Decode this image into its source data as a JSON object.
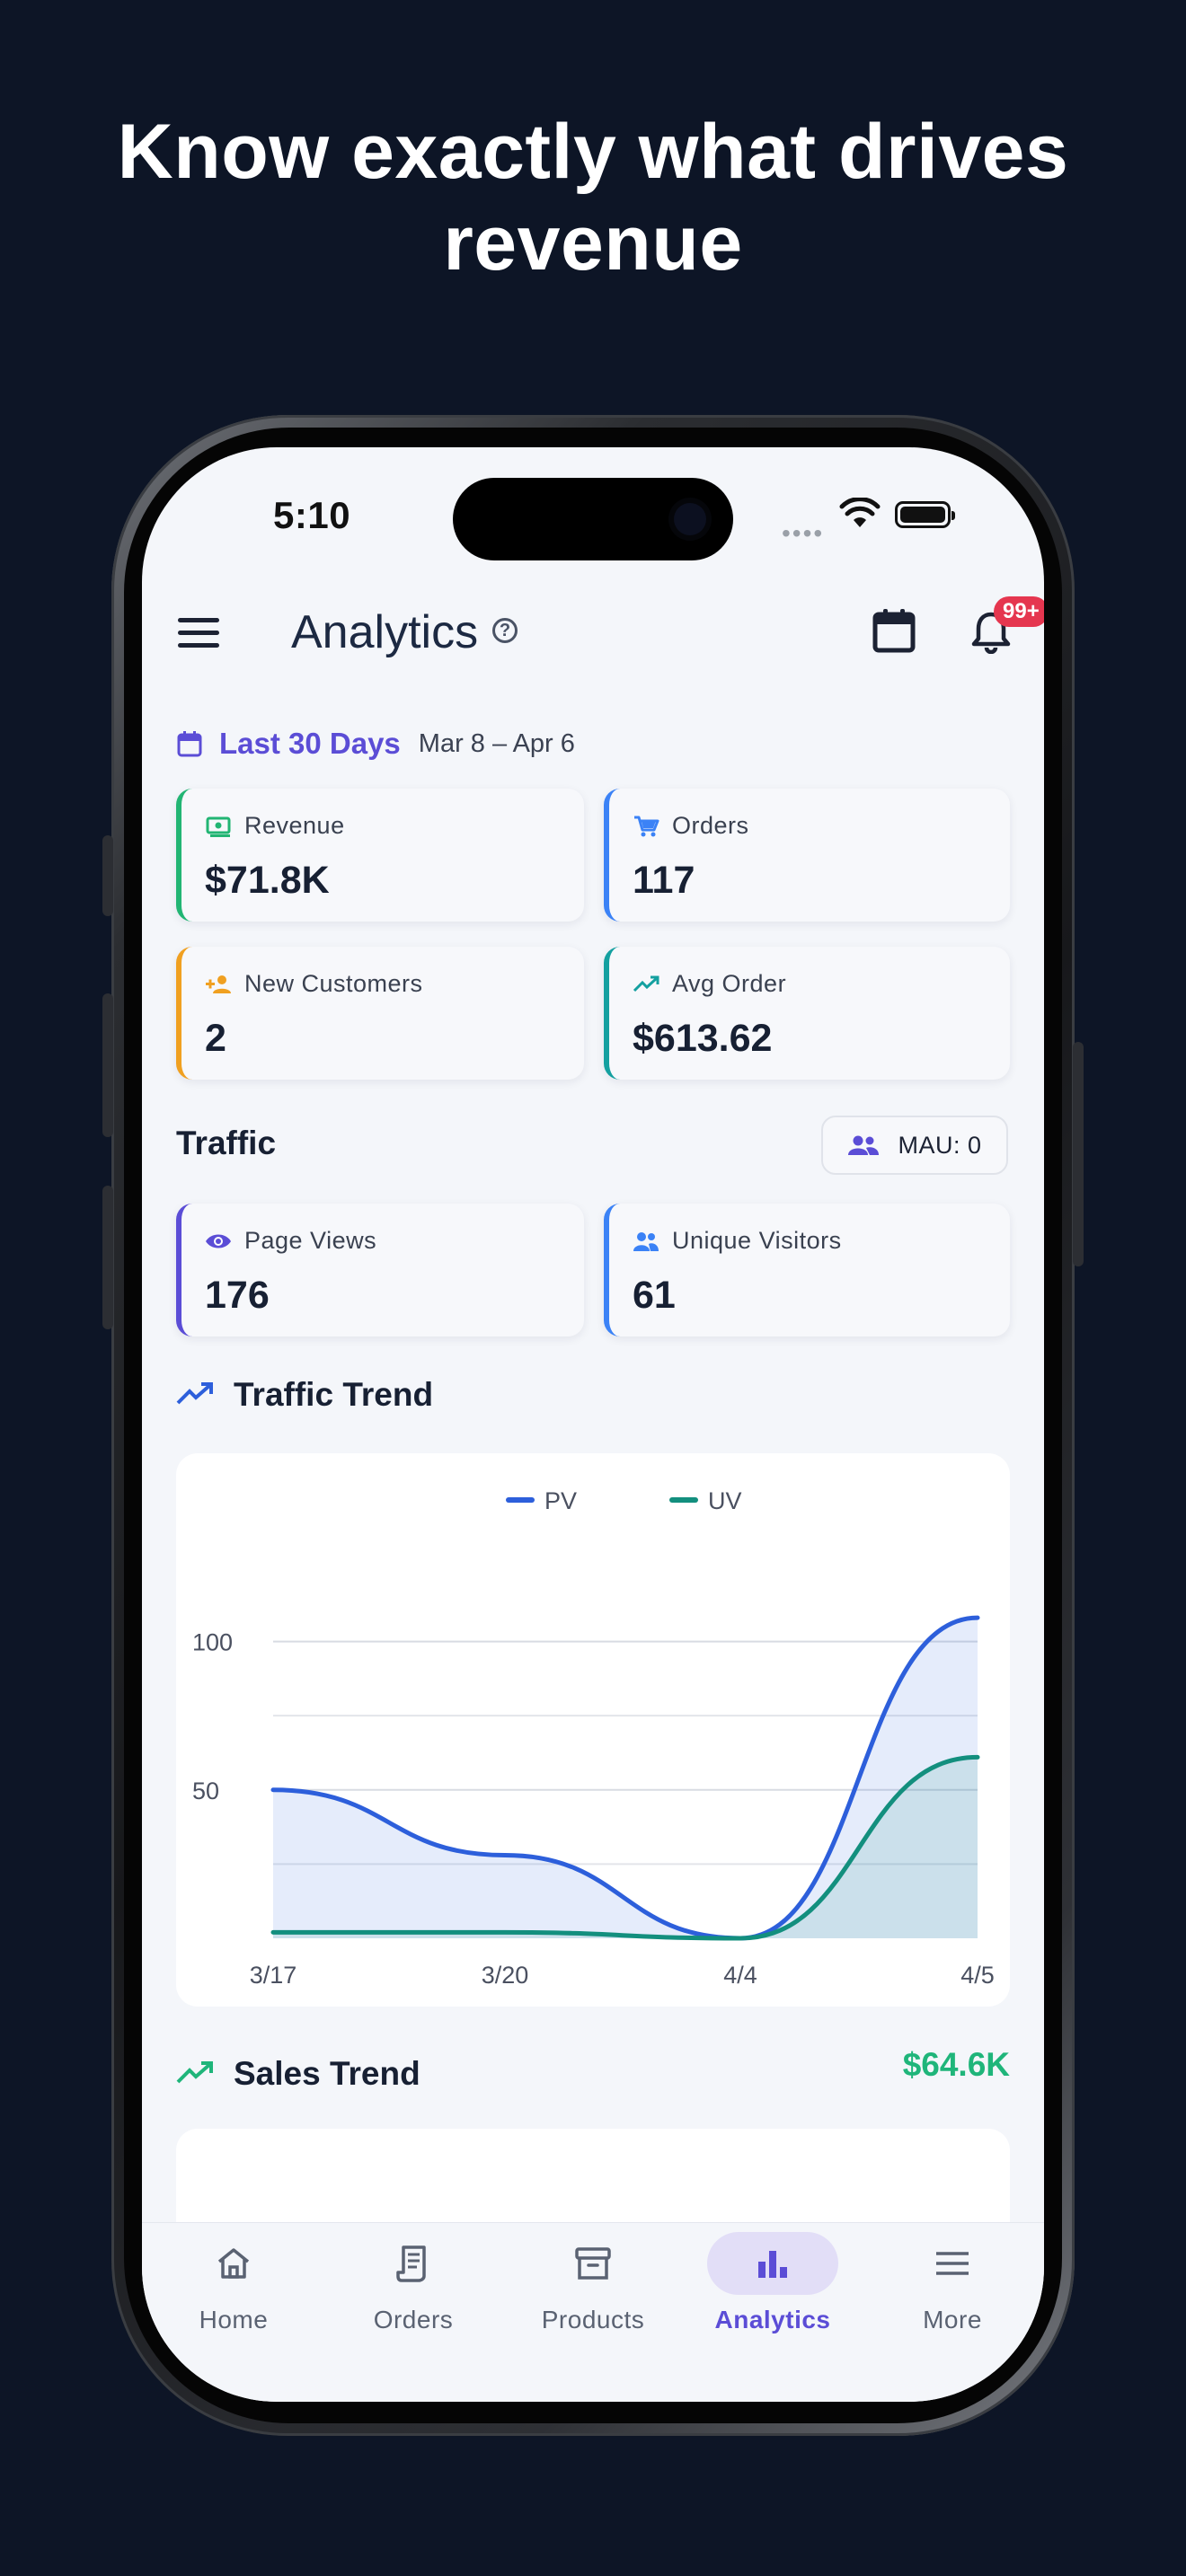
{
  "headline": "Know exactly what drives revenue",
  "status_bar": {
    "time": "5:10",
    "dots": "••••"
  },
  "header": {
    "title": "Analytics",
    "help": "?",
    "notifications_badge": "99+"
  },
  "date_filter": {
    "label": "Last 30 Days",
    "range": "Mar 8 – Apr 6"
  },
  "stats": [
    {
      "label": "Revenue",
      "value": "$71.8K",
      "icon": "money-icon",
      "color": "#22b573"
    },
    {
      "label": "Orders",
      "value": "117",
      "icon": "cart-icon",
      "color": "#3b82f6"
    },
    {
      "label": "New Customers",
      "value": "2",
      "icon": "person-add-icon",
      "color": "#f0a020"
    },
    {
      "label": "Avg Order",
      "value": "$613.62",
      "icon": "trending-up-icon",
      "color": "#14a0a0"
    }
  ],
  "traffic": {
    "title": "Traffic",
    "mau": "MAU: 0",
    "cards": [
      {
        "label": "Page Views",
        "value": "176",
        "icon": "eye-icon",
        "color": "#5b4dd6"
      },
      {
        "label": "Unique Visitors",
        "value": "61",
        "icon": "group-icon",
        "color": "#3b82f6"
      }
    ]
  },
  "traffic_trend": {
    "title": "Traffic Trend"
  },
  "chart_data": {
    "type": "area",
    "x": [
      "3/17",
      "3/20",
      "4/4",
      "4/5"
    ],
    "series": [
      {
        "name": "PV",
        "values": [
          50,
          28,
          0,
          108
        ],
        "color": "#2d5fdb"
      },
      {
        "name": "UV",
        "values": [
          2,
          2,
          0,
          61
        ],
        "color": "#138f7e"
      }
    ],
    "yticks": [
      50,
      100
    ],
    "ylim": [
      0,
      115
    ],
    "grid": true,
    "legend": "top-center"
  },
  "sales_trend": {
    "title": "Sales Trend",
    "total": "$64.6K"
  },
  "nav": [
    {
      "label": "Home",
      "icon": "home-icon",
      "active": false
    },
    {
      "label": "Orders",
      "icon": "receipt-icon",
      "active": false
    },
    {
      "label": "Products",
      "icon": "archive-icon",
      "active": false
    },
    {
      "label": "Analytics",
      "icon": "bar-chart-icon",
      "active": true
    },
    {
      "label": "More",
      "icon": "menu-icon",
      "active": false
    }
  ],
  "colors": {
    "accent": "#5b4dd6",
    "background": "#0d1526",
    "success": "#1fb57a"
  }
}
